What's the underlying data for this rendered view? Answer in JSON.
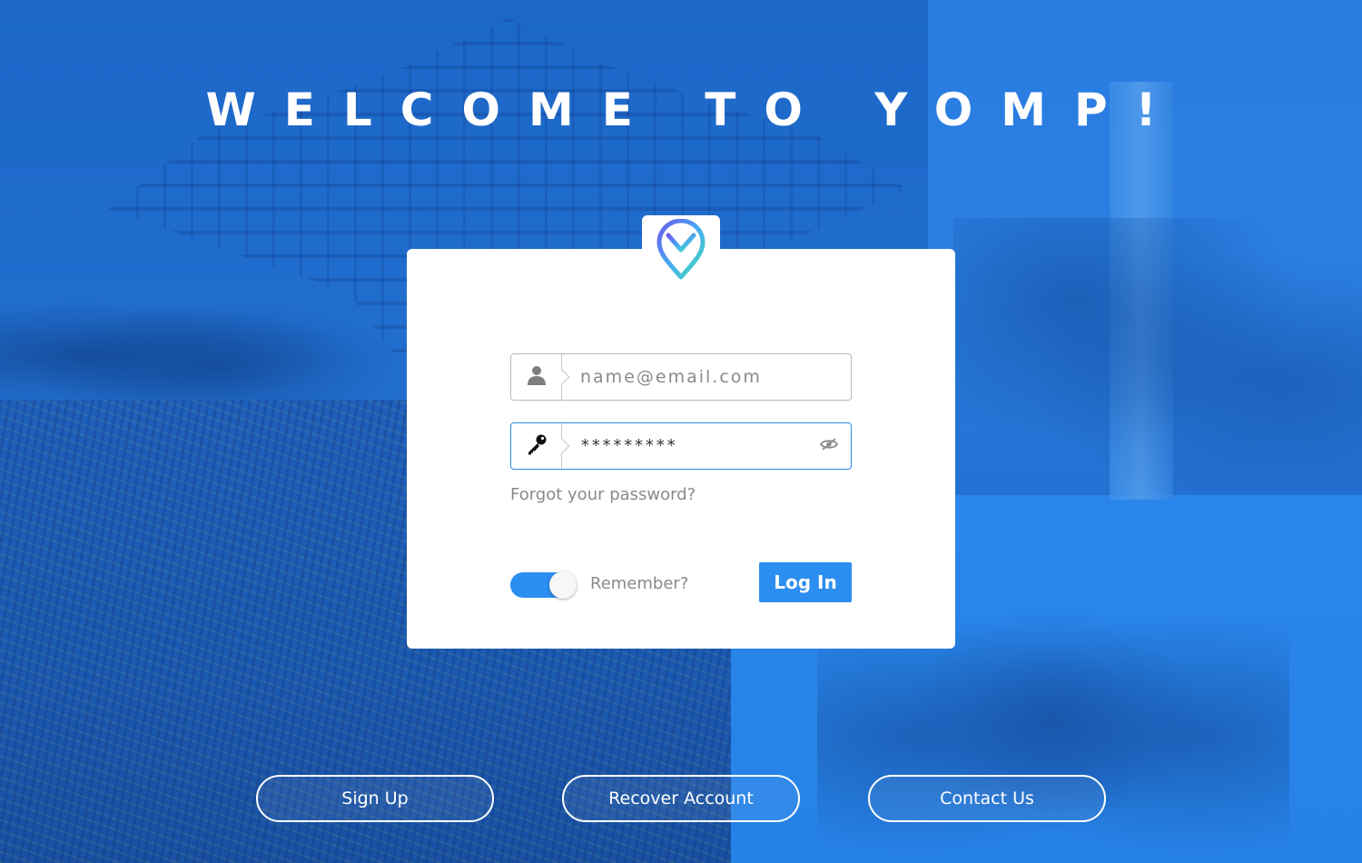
{
  "page": {
    "title": "WELCOME TO YOMP!"
  },
  "login": {
    "email_placeholder": "name@email.com",
    "email_value": "",
    "password_masked": "*********",
    "forgot_link": "Forgot your password?",
    "remember_label": "Remember?",
    "remember_on": true,
    "login_button": "Log In"
  },
  "footer": {
    "signup": "Sign Up",
    "recover": "Recover Account",
    "contact": "Contact Us"
  },
  "icons": {
    "logo": "yomp-logo-icon",
    "user": "user-icon",
    "key": "key-icon",
    "eye": "eye-hidden-icon"
  },
  "colors": {
    "accent": "#2b8ef0",
    "background": "#1e6fd0",
    "card": "#ffffff",
    "muted_text": "#8a8a8a"
  }
}
